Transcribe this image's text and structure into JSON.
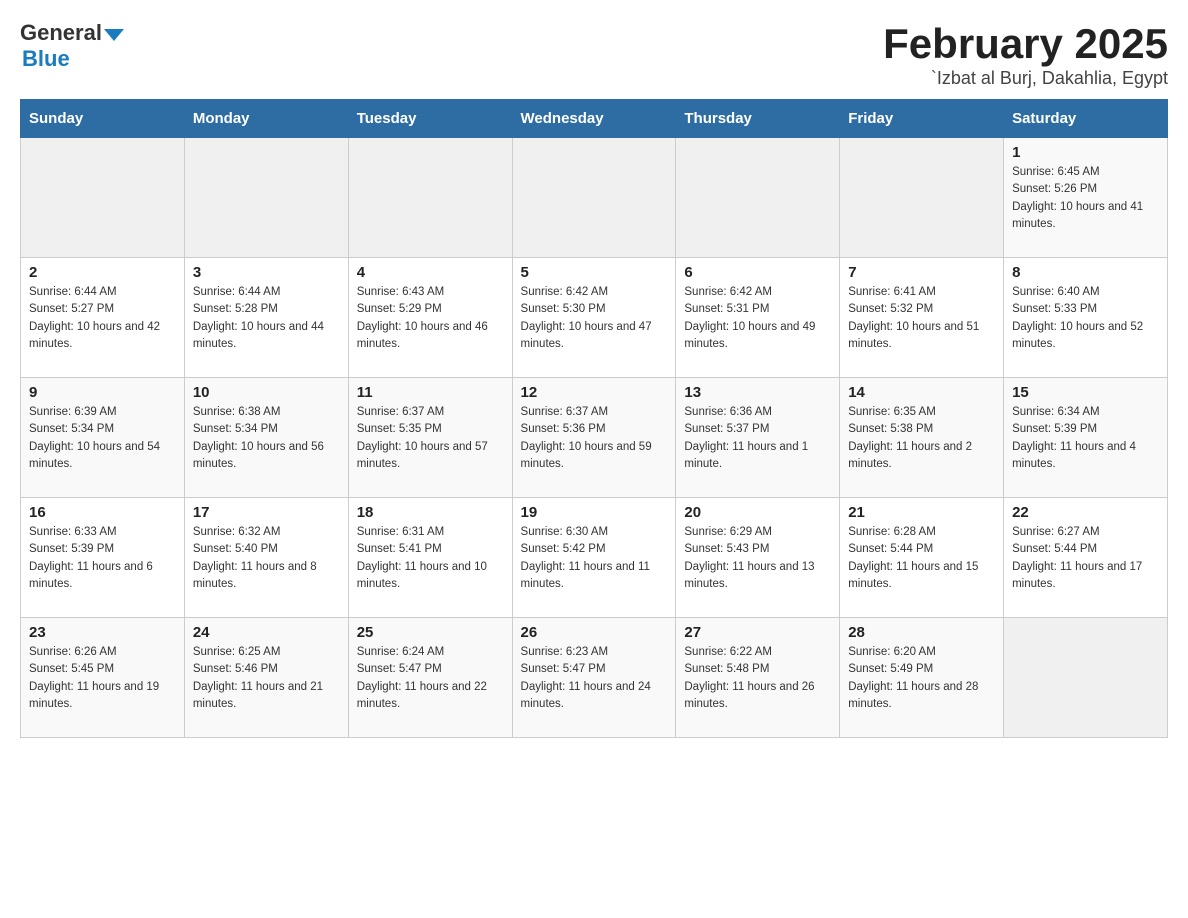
{
  "header": {
    "title": "February 2025",
    "location": "`Izbat al Burj, Dakahlia, Egypt",
    "logo_general": "General",
    "logo_blue": "Blue"
  },
  "days_of_week": [
    "Sunday",
    "Monday",
    "Tuesday",
    "Wednesday",
    "Thursday",
    "Friday",
    "Saturday"
  ],
  "weeks": [
    [
      {
        "day": "",
        "info": ""
      },
      {
        "day": "",
        "info": ""
      },
      {
        "day": "",
        "info": ""
      },
      {
        "day": "",
        "info": ""
      },
      {
        "day": "",
        "info": ""
      },
      {
        "day": "",
        "info": ""
      },
      {
        "day": "1",
        "info": "Sunrise: 6:45 AM\nSunset: 5:26 PM\nDaylight: 10 hours and 41 minutes."
      }
    ],
    [
      {
        "day": "2",
        "info": "Sunrise: 6:44 AM\nSunset: 5:27 PM\nDaylight: 10 hours and 42 minutes."
      },
      {
        "day": "3",
        "info": "Sunrise: 6:44 AM\nSunset: 5:28 PM\nDaylight: 10 hours and 44 minutes."
      },
      {
        "day": "4",
        "info": "Sunrise: 6:43 AM\nSunset: 5:29 PM\nDaylight: 10 hours and 46 minutes."
      },
      {
        "day": "5",
        "info": "Sunrise: 6:42 AM\nSunset: 5:30 PM\nDaylight: 10 hours and 47 minutes."
      },
      {
        "day": "6",
        "info": "Sunrise: 6:42 AM\nSunset: 5:31 PM\nDaylight: 10 hours and 49 minutes."
      },
      {
        "day": "7",
        "info": "Sunrise: 6:41 AM\nSunset: 5:32 PM\nDaylight: 10 hours and 51 minutes."
      },
      {
        "day": "8",
        "info": "Sunrise: 6:40 AM\nSunset: 5:33 PM\nDaylight: 10 hours and 52 minutes."
      }
    ],
    [
      {
        "day": "9",
        "info": "Sunrise: 6:39 AM\nSunset: 5:34 PM\nDaylight: 10 hours and 54 minutes."
      },
      {
        "day": "10",
        "info": "Sunrise: 6:38 AM\nSunset: 5:34 PM\nDaylight: 10 hours and 56 minutes."
      },
      {
        "day": "11",
        "info": "Sunrise: 6:37 AM\nSunset: 5:35 PM\nDaylight: 10 hours and 57 minutes."
      },
      {
        "day": "12",
        "info": "Sunrise: 6:37 AM\nSunset: 5:36 PM\nDaylight: 10 hours and 59 minutes."
      },
      {
        "day": "13",
        "info": "Sunrise: 6:36 AM\nSunset: 5:37 PM\nDaylight: 11 hours and 1 minute."
      },
      {
        "day": "14",
        "info": "Sunrise: 6:35 AM\nSunset: 5:38 PM\nDaylight: 11 hours and 2 minutes."
      },
      {
        "day": "15",
        "info": "Sunrise: 6:34 AM\nSunset: 5:39 PM\nDaylight: 11 hours and 4 minutes."
      }
    ],
    [
      {
        "day": "16",
        "info": "Sunrise: 6:33 AM\nSunset: 5:39 PM\nDaylight: 11 hours and 6 minutes."
      },
      {
        "day": "17",
        "info": "Sunrise: 6:32 AM\nSunset: 5:40 PM\nDaylight: 11 hours and 8 minutes."
      },
      {
        "day": "18",
        "info": "Sunrise: 6:31 AM\nSunset: 5:41 PM\nDaylight: 11 hours and 10 minutes."
      },
      {
        "day": "19",
        "info": "Sunrise: 6:30 AM\nSunset: 5:42 PM\nDaylight: 11 hours and 11 minutes."
      },
      {
        "day": "20",
        "info": "Sunrise: 6:29 AM\nSunset: 5:43 PM\nDaylight: 11 hours and 13 minutes."
      },
      {
        "day": "21",
        "info": "Sunrise: 6:28 AM\nSunset: 5:44 PM\nDaylight: 11 hours and 15 minutes."
      },
      {
        "day": "22",
        "info": "Sunrise: 6:27 AM\nSunset: 5:44 PM\nDaylight: 11 hours and 17 minutes."
      }
    ],
    [
      {
        "day": "23",
        "info": "Sunrise: 6:26 AM\nSunset: 5:45 PM\nDaylight: 11 hours and 19 minutes."
      },
      {
        "day": "24",
        "info": "Sunrise: 6:25 AM\nSunset: 5:46 PM\nDaylight: 11 hours and 21 minutes."
      },
      {
        "day": "25",
        "info": "Sunrise: 6:24 AM\nSunset: 5:47 PM\nDaylight: 11 hours and 22 minutes."
      },
      {
        "day": "26",
        "info": "Sunrise: 6:23 AM\nSunset: 5:47 PM\nDaylight: 11 hours and 24 minutes."
      },
      {
        "day": "27",
        "info": "Sunrise: 6:22 AM\nSunset: 5:48 PM\nDaylight: 11 hours and 26 minutes."
      },
      {
        "day": "28",
        "info": "Sunrise: 6:20 AM\nSunset: 5:49 PM\nDaylight: 11 hours and 28 minutes."
      },
      {
        "day": "",
        "info": ""
      }
    ]
  ]
}
